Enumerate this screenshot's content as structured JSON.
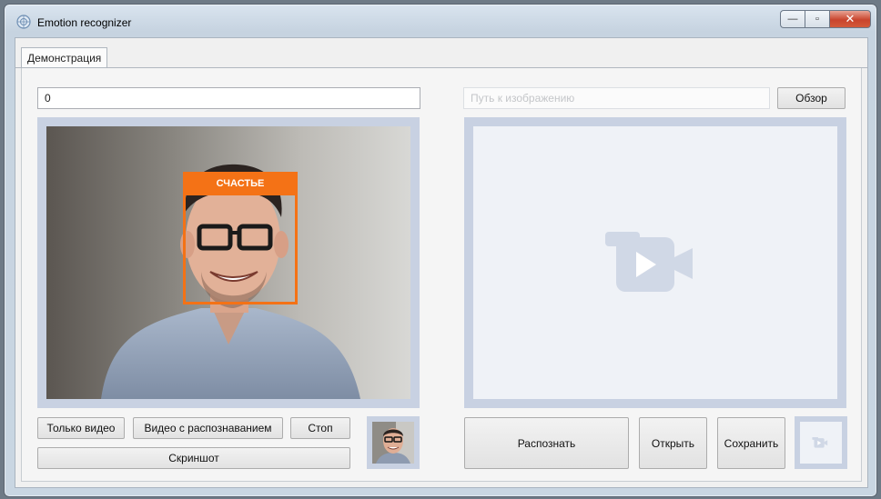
{
  "window": {
    "title": "Emotion recognizer",
    "minimize_glyph": "—",
    "maximize_glyph": "▫",
    "close_glyph": "✕"
  },
  "tabs": [
    {
      "label": "Демонстрация",
      "active": true
    }
  ],
  "left_panel": {
    "camera_index_value": "0",
    "detection_label": "СЧАСТЬЕ",
    "buttons": {
      "video_only": "Только видео",
      "video_recognition": "Видео с распознаванием",
      "stop": "Стоп",
      "screenshot": "Скриншот"
    }
  },
  "right_panel": {
    "path_placeholder": "Путь к изображению",
    "path_value": "",
    "browse_label": "Обзор",
    "preview_icon": "video-camera-play-icon",
    "buttons": {
      "recognize": "Распознать",
      "open": "Открыть",
      "save": "Сохранить"
    },
    "mini_icon": "video-camera-icon"
  },
  "colors": {
    "frame": "#c8d1e2",
    "detection_box": "#f47216",
    "preview_bg": "#eff2f7",
    "icon": "#d0d8e6"
  }
}
